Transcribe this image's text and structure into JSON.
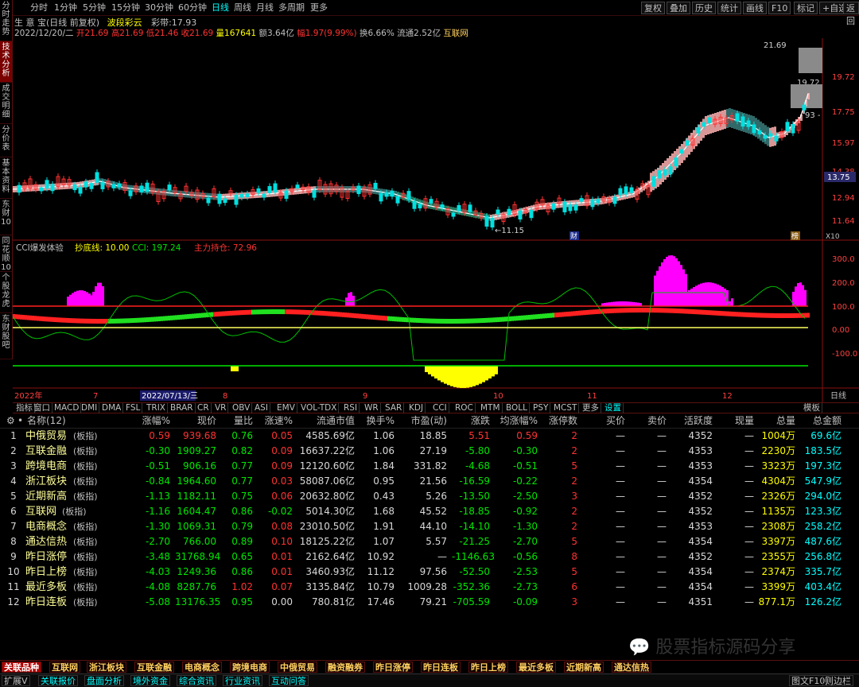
{
  "left_nav": [
    {
      "label": "分时走势",
      "active": false
    },
    {
      "label": "技术分析",
      "active": true
    },
    {
      "label": "成交明细",
      "active": false
    },
    {
      "label": "分价表",
      "active": false
    },
    {
      "label": "基本资料",
      "active": false
    },
    {
      "label": "东财10",
      "active": false
    },
    {
      "label": "同花顺10",
      "active": false
    },
    {
      "label": "个股龙虎",
      "active": false
    },
    {
      "label": "东财股吧",
      "active": false
    }
  ],
  "toolbar": {
    "periods": [
      "分时",
      "1分钟",
      "5分钟",
      "15分钟",
      "30分钟",
      "60分钟",
      "日线",
      "周线",
      "月线",
      "多周期",
      "更多"
    ],
    "selected": "日线",
    "right_buttons": [
      "复权",
      "叠加",
      "历史",
      "统计",
      "画线",
      "F10",
      "标记",
      "+自选",
      "返回"
    ]
  },
  "stock_info": {
    "name": "生 意 宝(日线 前复权)",
    "tag": "波段彩云",
    "cai_dai": "彩带:17.93",
    "date": "2022/12/20/二",
    "open": "开21.69",
    "high": "高21.69",
    "low": "低21.46",
    "close": "收21.69",
    "volume": "量167641",
    "amount": "额3.64亿",
    "change": "幅1.97(9.99%)",
    "turnover": "换6.66%",
    "float_cap": "流通2.52亿",
    "concept": "互联网"
  },
  "price_axis": [
    "19.72",
    "17.75",
    "15.97",
    "14.38",
    "12.94",
    "11.64"
  ],
  "price_marks": {
    "high": "21.69",
    "mid": "19.72",
    "right": "93 -",
    "cur": "13.75",
    "low": "←11.15",
    "cai": "财",
    "bang": "榜",
    "zoom": "X10"
  },
  "indicator": {
    "name": "CCI爆发体验",
    "param1": "抄底线: 10.00",
    "param2": "CCI: 197.24",
    "param3": "主力持仓: 72.96",
    "axis": [
      "300.0",
      "200.0",
      "100.0",
      "0.00",
      "-100.0"
    ]
  },
  "time_axis": {
    "labels": [
      "2022年",
      "7",
      "8",
      "9",
      "10",
      "11",
      "12"
    ],
    "cursor_date": "2022/07/13/三",
    "end_label": "日线"
  },
  "indicator_tabs": [
    "指标",
    "窗口",
    "MACD",
    "DMI",
    "DMA",
    "FSL",
    "TRIX",
    "BRAR",
    "CR",
    "VR",
    "OBV",
    "ASI",
    "EMV",
    "VOL-TDX",
    "RSI",
    "WR",
    "SAR",
    "KDJ",
    "CCI",
    "ROC",
    "MTM",
    "BOLL",
    "PSY",
    "MCST",
    "更多",
    "设置"
  ],
  "indicator_right": "模板",
  "table": {
    "headers": [
      "名称(12)",
      "涨幅%",
      "现价",
      "量比",
      "涨速%",
      "流通市值",
      "换手%",
      "市盈(动)",
      "涨跌",
      "均涨幅%",
      "涨停数",
      "买价",
      "卖价",
      "活跃度",
      "现量",
      "总量",
      "总金额"
    ],
    "tag": "(板指)",
    "rows": [
      {
        "no": "1",
        "name": "中俄贸易",
        "chg": "0.59",
        "price": "939.68",
        "vr": "0.76",
        "spd": "0.05",
        "cap": "4585.69亿",
        "to": "1.06",
        "pe": "18.85",
        "diff": "5.51",
        "avg": "0.59",
        "lim": "2",
        "buy": "—",
        "sell": "—",
        "act": "4352",
        "cur": "—",
        "vol": "1004万",
        "amt": "69.6亿"
      },
      {
        "no": "2",
        "name": "互联金融",
        "chg": "-0.30",
        "price": "1909.27",
        "vr": "0.82",
        "spd": "0.09",
        "cap": "16637.22亿",
        "to": "1.06",
        "pe": "27.19",
        "diff": "-5.80",
        "avg": "-0.30",
        "lim": "2",
        "buy": "—",
        "sell": "—",
        "act": "4353",
        "cur": "—",
        "vol": "2230万",
        "amt": "183.5亿"
      },
      {
        "no": "3",
        "name": "跨境电商",
        "chg": "-0.51",
        "price": "906.16",
        "vr": "0.77",
        "spd": "0.09",
        "cap": "12120.60亿",
        "to": "1.84",
        "pe": "331.82",
        "diff": "-4.68",
        "avg": "-0.51",
        "lim": "5",
        "buy": "—",
        "sell": "—",
        "act": "4353",
        "cur": "—",
        "vol": "3323万",
        "amt": "197.3亿"
      },
      {
        "no": "4",
        "name": "浙江板块",
        "chg": "-0.84",
        "price": "1964.60",
        "vr": "0.77",
        "spd": "0.03",
        "cap": "58087.06亿",
        "to": "0.95",
        "pe": "21.56",
        "diff": "-16.59",
        "avg": "-0.22",
        "lim": "2",
        "buy": "—",
        "sell": "—",
        "act": "4354",
        "cur": "—",
        "vol": "4304万",
        "amt": "547.9亿"
      },
      {
        "no": "5",
        "name": "近期新高",
        "chg": "-1.13",
        "price": "1182.11",
        "vr": "0.75",
        "spd": "0.06",
        "cap": "20632.80亿",
        "to": "0.43",
        "pe": "5.26",
        "diff": "-13.50",
        "avg": "-2.50",
        "lim": "3",
        "buy": "—",
        "sell": "—",
        "act": "4352",
        "cur": "—",
        "vol": "2326万",
        "amt": "294.0亿"
      },
      {
        "no": "6",
        "name": "互联网",
        "chg": "-1.16",
        "price": "1604.47",
        "vr": "0.86",
        "spd": "-0.02",
        "cap": "5014.30亿",
        "to": "1.68",
        "pe": "45.52",
        "diff": "-18.85",
        "avg": "-0.92",
        "lim": "2",
        "buy": "—",
        "sell": "—",
        "act": "4352",
        "cur": "—",
        "vol": "1135万",
        "amt": "123.3亿"
      },
      {
        "no": "7",
        "name": "电商概念",
        "chg": "-1.30",
        "price": "1069.31",
        "vr": "0.79",
        "spd": "0.08",
        "cap": "23010.50亿",
        "to": "1.91",
        "pe": "44.10",
        "diff": "-14.10",
        "avg": "-1.30",
        "lim": "2",
        "buy": "—",
        "sell": "—",
        "act": "4353",
        "cur": "—",
        "vol": "2308万",
        "amt": "258.2亿"
      },
      {
        "no": "8",
        "name": "通达信热",
        "chg": "-2.70",
        "price": "766.00",
        "vr": "0.89",
        "spd": "0.10",
        "cap": "18125.22亿",
        "to": "1.07",
        "pe": "5.57",
        "diff": "-21.25",
        "avg": "-2.70",
        "lim": "5",
        "buy": "—",
        "sell": "—",
        "act": "4354",
        "cur": "—",
        "vol": "3397万",
        "amt": "487.6亿"
      },
      {
        "no": "9",
        "name": "昨日涨停",
        "chg": "-3.48",
        "price": "31768.94",
        "vr": "0.65",
        "spd": "0.01",
        "cap": "2162.64亿",
        "to": "10.92",
        "pe": "—",
        "diff": "-1146.63",
        "avg": "-0.56",
        "lim": "8",
        "buy": "—",
        "sell": "—",
        "act": "4352",
        "cur": "—",
        "vol": "2355万",
        "amt": "256.8亿"
      },
      {
        "no": "10",
        "name": "昨日上榜",
        "chg": "-4.03",
        "price": "1249.36",
        "vr": "0.86",
        "spd": "0.01",
        "cap": "3460.93亿",
        "to": "11.12",
        "pe": "97.56",
        "diff": "-52.50",
        "avg": "-2.53",
        "lim": "5",
        "buy": "—",
        "sell": "—",
        "act": "4354",
        "cur": "—",
        "vol": "2374万",
        "amt": "335.7亿"
      },
      {
        "no": "11",
        "name": "最近多板",
        "chg": "-4.08",
        "price": "8287.76",
        "vr": "1.02",
        "spd": "0.07",
        "cap": "3135.84亿",
        "to": "10.79",
        "pe": "1009.28",
        "diff": "-352.36",
        "avg": "-2.73",
        "lim": "6",
        "buy": "—",
        "sell": "—",
        "act": "4354",
        "cur": "—",
        "vol": "3399万",
        "amt": "403.4亿"
      },
      {
        "no": "12",
        "name": "昨日连板",
        "chg": "-5.08",
        "price": "13176.35",
        "vr": "0.95",
        "spd": "0.00",
        "cap": "780.81亿",
        "to": "17.46",
        "pe": "79.21",
        "diff": "-705.59",
        "avg": "-0.09",
        "lim": "3",
        "buy": "—",
        "sell": "—",
        "act": "4351",
        "cur": "—",
        "vol": "877.1万",
        "amt": "126.2亿"
      }
    ]
  },
  "bottom_tabs": [
    "关联品种",
    "互联网",
    "浙江板块",
    "互联金融",
    "电商概念",
    "跨境电商",
    "中俄贸易",
    "融资融券",
    "昨日涨停",
    "昨日连板",
    "昨日上榜",
    "最近多板",
    "近期新高",
    "通达信热"
  ],
  "bottom_bar": [
    "扩展V",
    "关联报价",
    "盘面分析",
    "境外资金",
    "综合资讯",
    "行业资讯",
    "互动问答"
  ],
  "bottom_right": [
    "图文F10",
    "则边栏"
  ],
  "watermark": "股票指标源码分享",
  "colors": {
    "up": "#ff3232",
    "down": "#00e600",
    "name": "#ffff99",
    "cyan": "#00ffff",
    "magenta": "#ff00ff",
    "yellow": "#ffff00"
  }
}
